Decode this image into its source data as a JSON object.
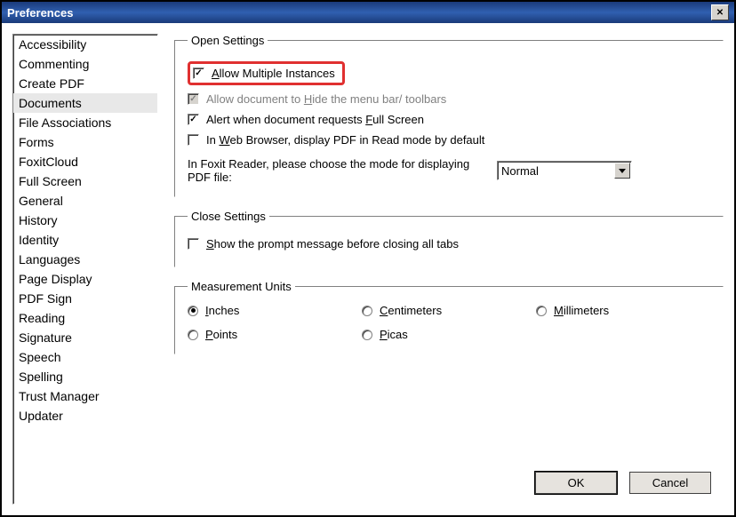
{
  "window": {
    "title": "Preferences"
  },
  "sidebar": {
    "items": [
      "Accessibility",
      "Commenting",
      "Create PDF",
      "Documents",
      "File Associations",
      "Forms",
      "FoxitCloud",
      "Full Screen",
      "General",
      "History",
      "Identity",
      "Languages",
      "Page Display",
      "PDF Sign",
      "Reading",
      "Signature",
      "Speech",
      "Spelling",
      "Trust Manager",
      "Updater"
    ],
    "selected": "Documents"
  },
  "openSettings": {
    "legend": "Open Settings",
    "allowMultiple": {
      "label_pre": "A",
      "label_rest": "llow Multiple Instances",
      "checked": true
    },
    "allowHideMenu": {
      "label_pre": "Allow document to ",
      "label_u": "H",
      "label_rest": "ide the menu bar/ toolbars",
      "checked": true,
      "disabled": true
    },
    "alertFullScreen": {
      "label_pre": "Alert when document requests ",
      "label_u": "F",
      "label_rest": "ull Screen",
      "checked": true
    },
    "webBrowser": {
      "label_pre": "In ",
      "label_u": "W",
      "label_rest": "eb Browser, display PDF in Read mode by default",
      "checked": false
    },
    "modeLabel": "In Foxit Reader, please choose the mode for displaying PDF file:",
    "modeValue": "Normal"
  },
  "closeSettings": {
    "legend": "Close Settings",
    "showPrompt": {
      "label_u": "S",
      "label_rest": "how the prompt message before closing all tabs",
      "checked": false
    }
  },
  "units": {
    "legend": "Measurement Units",
    "options": [
      {
        "key": "inches",
        "u": "I",
        "rest": "nches",
        "checked": true
      },
      {
        "key": "centimeters",
        "u": "C",
        "rest": "entimeters",
        "checked": false
      },
      {
        "key": "millimeters",
        "u": "M",
        "rest": "illimeters",
        "checked": false
      },
      {
        "key": "points",
        "u": "P",
        "rest": "oints",
        "checked": false
      },
      {
        "key": "picas",
        "u": "P",
        "rest": "icas",
        "checked": false
      }
    ]
  },
  "buttons": {
    "ok": "OK",
    "cancel": "Cancel"
  }
}
